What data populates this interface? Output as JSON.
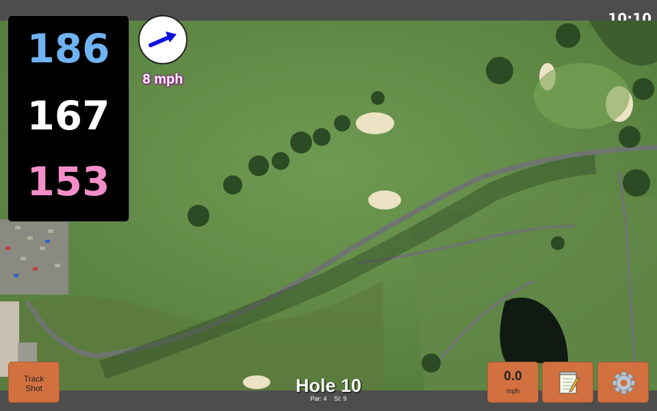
{
  "status": {
    "time": "10:10"
  },
  "distances": {
    "front": "186",
    "middle": "167",
    "back": "153"
  },
  "colors": {
    "front": "#6fb3f2",
    "middle": "#ffffff",
    "back": "#f48ec8",
    "button": "#d2713f"
  },
  "wind": {
    "icon": "wind-arrow-icon",
    "speed_label": "8 mph",
    "direction": "north-east"
  },
  "track_shot": {
    "line1": "Track",
    "line2": "Shot"
  },
  "speed": {
    "value": "0.0",
    "unit": "mph"
  },
  "notes": {
    "icon": "notepad-icon"
  },
  "settings": {
    "icon": "gear-icon"
  },
  "hole": {
    "title": "Hole 10",
    "par": "Par: 4",
    "si": "SI: 9"
  }
}
